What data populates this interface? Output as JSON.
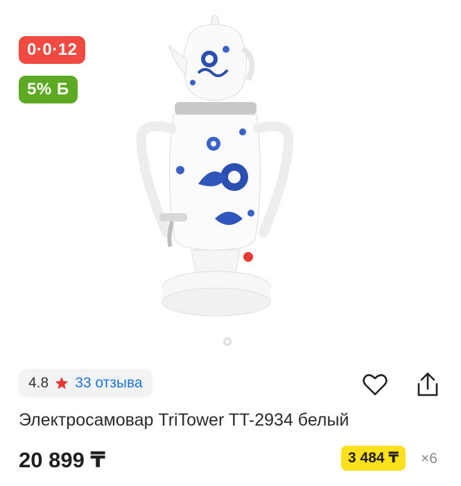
{
  "badges": {
    "installment": "0·0·12",
    "bonus": "5% Б"
  },
  "rating": {
    "value": "4.8",
    "reviews": "33 отзыва"
  },
  "product": {
    "title": "Электросамовар TriTower TT-2934 белый",
    "price": "20 899 ₸",
    "installment_amount": "3 484 ₸",
    "installment_months": "×6"
  },
  "gallery": {
    "dots_count": 1
  },
  "icons": {
    "favorite": "heart-icon",
    "share": "share-icon",
    "star": "star-icon"
  },
  "colors": {
    "installment_badge": "#f04a41",
    "bonus_badge": "#5daa22",
    "link": "#1a73d9",
    "star": "#e53935",
    "installment_pill": "#ffe11b"
  }
}
